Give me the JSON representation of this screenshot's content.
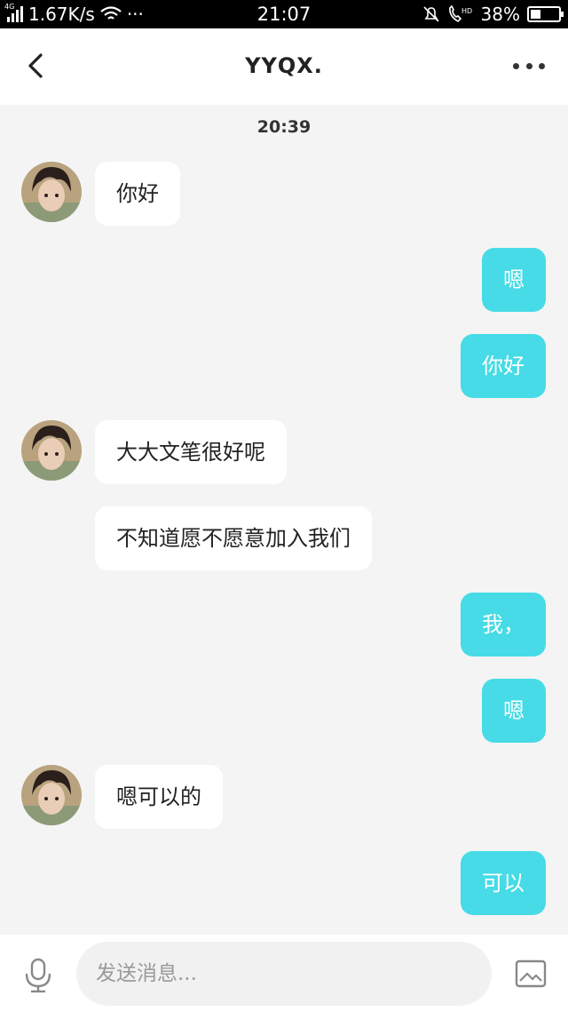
{
  "status_bar": {
    "network_tag": "4G",
    "speed": "1.67K/s",
    "dots": "···",
    "time": "21:07",
    "hd_tag": "HD",
    "battery": "38%",
    "battery_level": 0.38
  },
  "header": {
    "title": "YYQX.",
    "back_icon": "chevron-left-icon",
    "more_icon": "more-dots-icon"
  },
  "chat": {
    "time_label": "20:39",
    "messages": [
      {
        "side": "in",
        "text": "你好",
        "avatar": true
      },
      {
        "side": "out",
        "text": "嗯"
      },
      {
        "side": "out",
        "text": "你好"
      },
      {
        "side": "in",
        "text": "大大文笔很好呢",
        "avatar": true
      },
      {
        "side": "in",
        "text": "不知道愿不愿意加入我们",
        "avatar": false
      },
      {
        "side": "out",
        "text": "我，"
      },
      {
        "side": "out",
        "text": "嗯"
      },
      {
        "side": "in",
        "text": "嗯可以的",
        "avatar": true
      },
      {
        "side": "out",
        "text": "可以"
      }
    ]
  },
  "input_bar": {
    "placeholder": "发送消息...",
    "mic_icon": "microphone-icon",
    "image_icon": "image-icon"
  },
  "colors": {
    "outgoing_bubble": "#46dbe6",
    "incoming_bubble": "#ffffff",
    "background": "#f4f4f4"
  }
}
